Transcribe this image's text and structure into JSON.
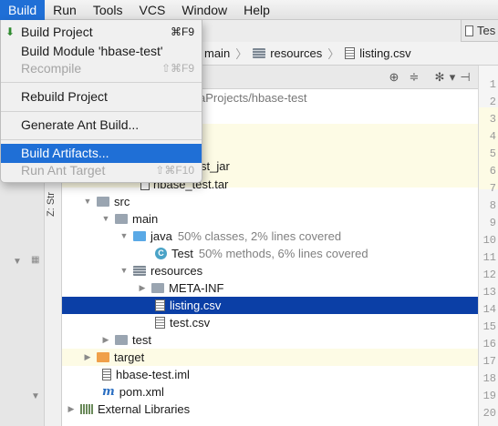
{
  "menubar": {
    "items": [
      "Build",
      "Run",
      "Tools",
      "VCS",
      "Window",
      "Help"
    ]
  },
  "editor_tab": {
    "label": "Tes"
  },
  "breadcrumb": {
    "items": [
      "main",
      "resources",
      "listing.csv"
    ]
  },
  "project_path": "aProjects/hbase-test",
  "tool_window_label": "Z: Str",
  "build_menu": {
    "items": [
      {
        "label": "Build Project",
        "shortcut": "⌘F9",
        "enabled": true
      },
      {
        "label": "Build Module 'hbase-test'",
        "shortcut": "",
        "enabled": true
      },
      {
        "label": "Recompile",
        "shortcut": "⇧⌘F9",
        "enabled": false
      },
      {
        "label": "Rebuild Project",
        "shortcut": "",
        "enabled": true
      },
      {
        "label": "Generate Ant Build...",
        "shortcut": "",
        "enabled": true
      },
      {
        "label": "Build Artifacts...",
        "shortcut": "",
        "enabled": true,
        "highlighted": true
      },
      {
        "label": "Run Ant Target",
        "shortcut": "⇧⌘F10",
        "enabled": false
      }
    ]
  },
  "tree": {
    "partial_items": [
      "st_jar",
      "hbase_test.tar"
    ],
    "src": "src",
    "main": "main",
    "java": "java",
    "java_coverage": "50% classes, 2% lines covered",
    "test_class": "Test",
    "test_coverage": "50% methods, 6% lines covered",
    "resources": "resources",
    "meta_inf": "META-INF",
    "listing_csv": "listing.csv",
    "test_csv": "test.csv",
    "test_dir": "test",
    "target": "target",
    "iml": "hbase-test.iml",
    "pom": "pom.xml",
    "external_libraries": "External Libraries"
  },
  "line_numbers": [
    "1",
    "2",
    "3",
    "4",
    "5",
    "6",
    "7",
    "8",
    "9",
    "10",
    "11",
    "12",
    "13",
    "14",
    "15",
    "16",
    "17",
    "18",
    "19",
    "20"
  ],
  "colors": {
    "menu_highlight": "#1f6fd6",
    "selection": "#0b3fa6",
    "coverage_text": "#808080"
  }
}
